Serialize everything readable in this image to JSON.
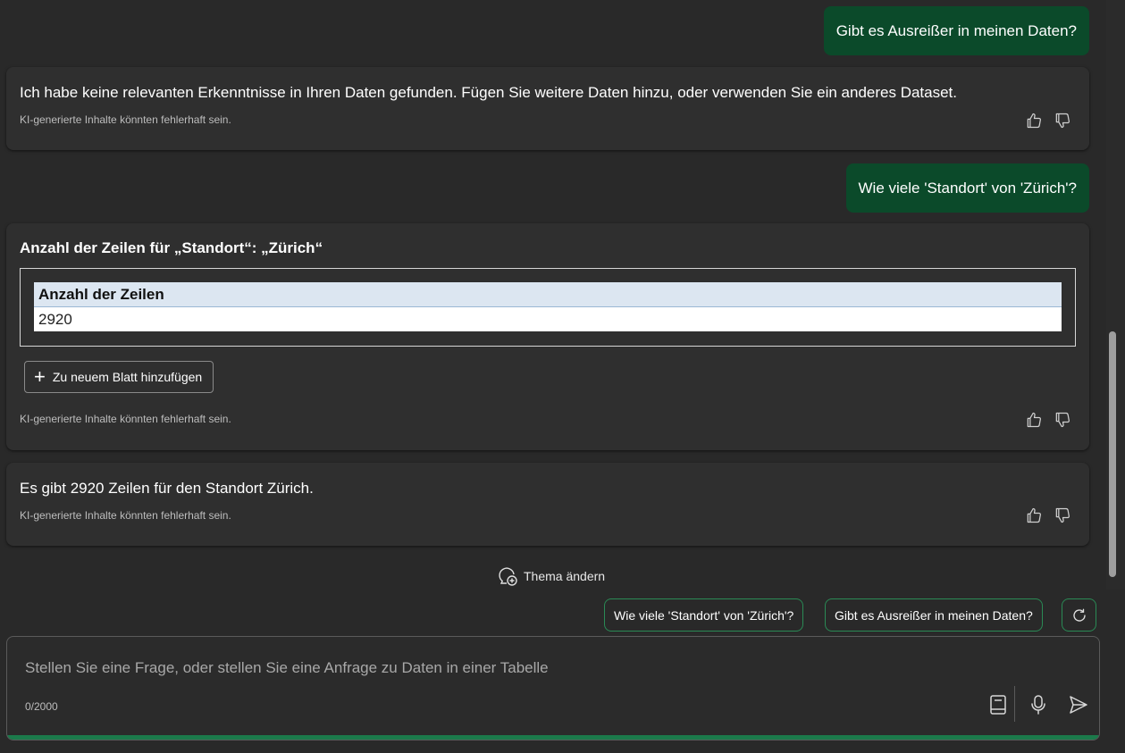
{
  "messages": {
    "user_1": "Gibt es Ausreißer in meinen Daten?",
    "reply_1": "Ich habe keine relevanten Erkenntnisse in Ihren Daten gefunden. Fügen Sie weitere Daten hinzu, oder verwenden Sie ein anderes Dataset.",
    "user_2": "Wie viele 'Standort' von 'Zürich'?",
    "reply_2_title": "Anzahl der Zeilen für „Standort“: „Zürich“",
    "reply_2_table": {
      "header": "Anzahl der Zeilen",
      "value": "2920"
    },
    "reply_2_add_button": "Zu neuem Blatt hinzufügen",
    "reply_3": "Es gibt 2920 Zeilen für den Standort Zürich."
  },
  "disclaimer": "KI-generierte Inhalte könnten fehlerhaft sein.",
  "change_topic": "Thema ändern",
  "suggestions": [
    "Wie viele 'Standort' von 'Zürich'?",
    "Gibt es Ausreißer in meinen Daten?"
  ],
  "composer": {
    "placeholder": "Stellen Sie eine Frage, oder stellen Sie eine Anfrage zu Daten in einer Tabelle",
    "counter": "0/2000"
  },
  "colors": {
    "background": "#292929",
    "user_bubble": "#0b4a2a",
    "accent": "#1b7a4b",
    "table_header": "#dce6f1"
  },
  "icons": [
    "thumbs-up-icon",
    "thumbs-down-icon",
    "plus-icon",
    "chat-add-icon",
    "refresh-icon",
    "book-icon",
    "microphone-icon",
    "send-icon"
  ]
}
